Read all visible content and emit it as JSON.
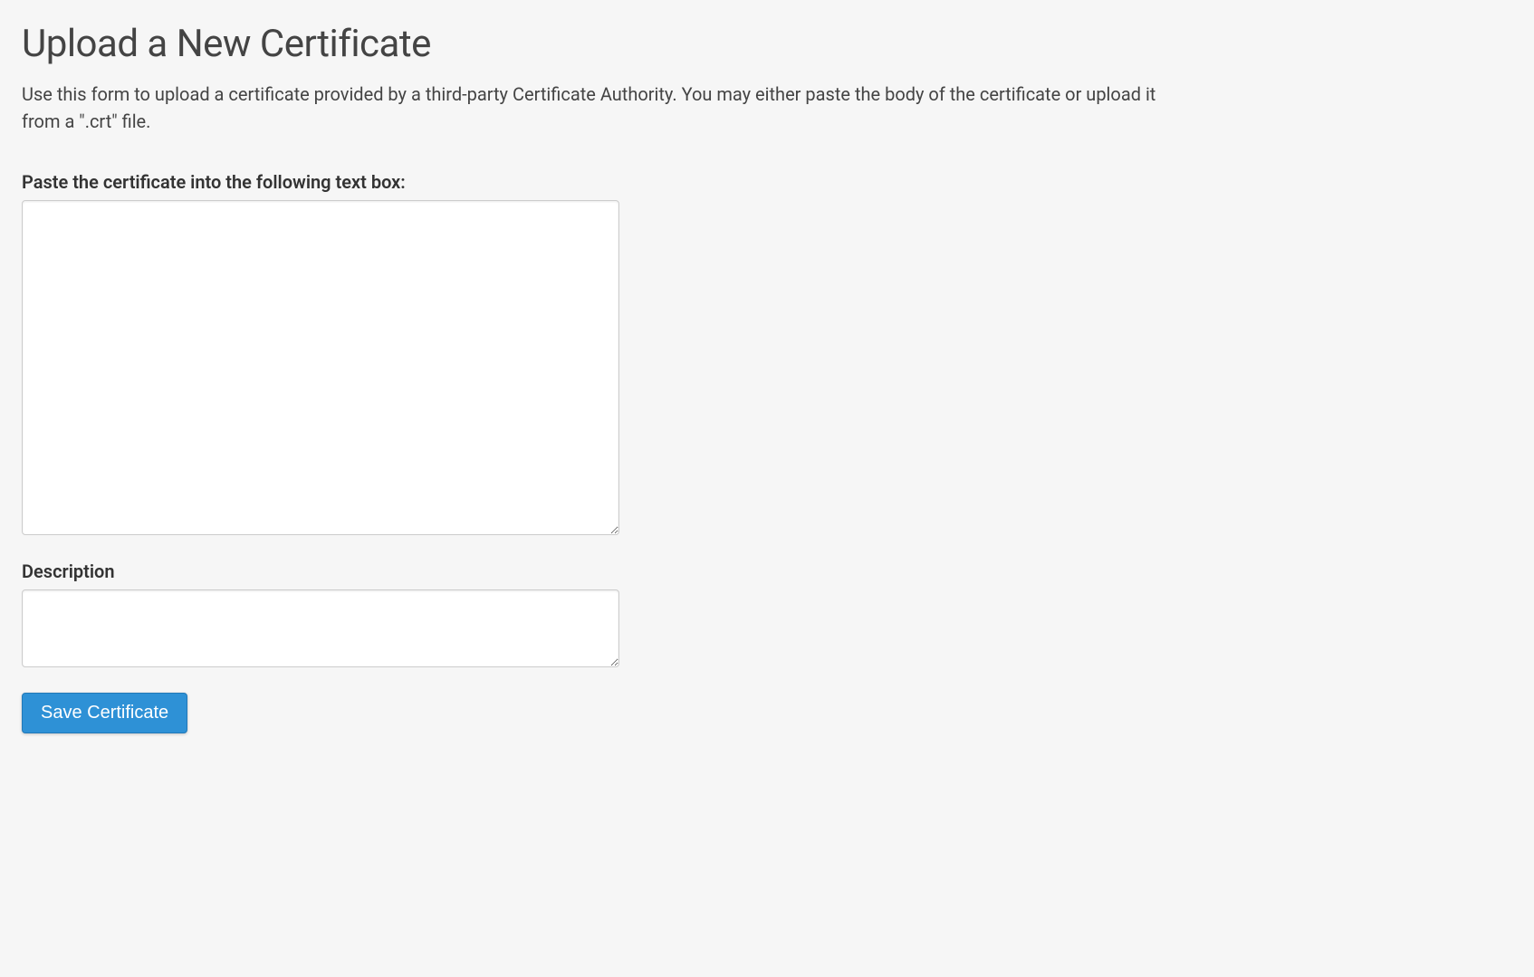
{
  "page": {
    "title": "Upload a New Certificate",
    "description": "Use this form to upload a certificate provided by a third-party Certificate Authority. You may either paste the body of the certificate or upload it from a \".crt\" file."
  },
  "form": {
    "certificate_label": "Paste the certificate into the following text box:",
    "certificate_value": "",
    "description_label": "Description",
    "description_value": "",
    "submit_label": "Save Certificate"
  }
}
